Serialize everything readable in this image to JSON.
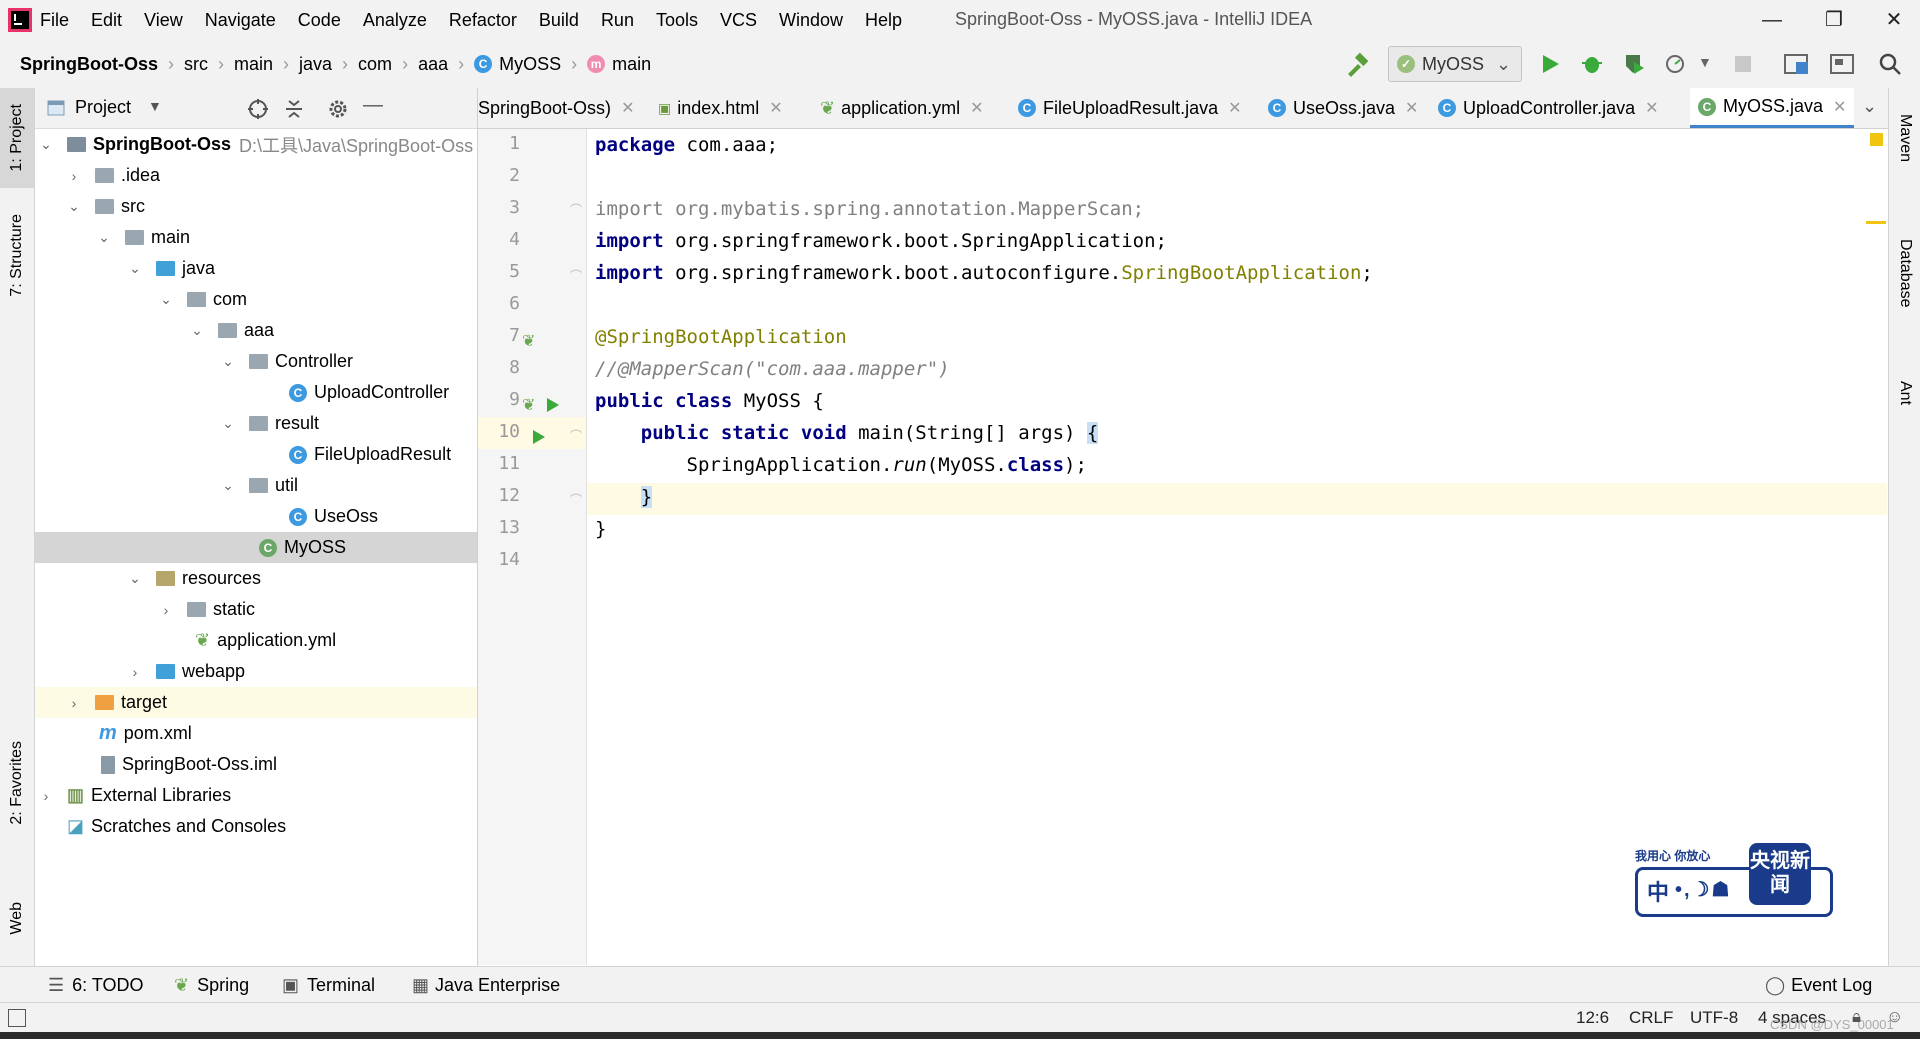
{
  "titlebar": {
    "menu": [
      "File",
      "Edit",
      "View",
      "Navigate",
      "Code",
      "Analyze",
      "Refactor",
      "Build",
      "Run",
      "Tools",
      "VCS",
      "Window",
      "Help"
    ],
    "title": "SpringBoot-Oss - MyOSS.java - IntelliJ IDEA",
    "minimize": "—",
    "restore": "❐",
    "close": "✕"
  },
  "navbar": {
    "breadcrumbs": [
      "SpringBoot-Oss",
      "src",
      "main",
      "java",
      "com",
      "aaa",
      "MyOSS",
      "main"
    ],
    "run_config": "MyOSS"
  },
  "leftstrip": {
    "project": "1: Project",
    "structure": "7: Structure",
    "favorites": "2: Favorites",
    "web": "Web"
  },
  "rightstrip": {
    "maven": "Maven",
    "database": "Database",
    "ant": "Ant"
  },
  "project": {
    "header_label": "Project",
    "root_name": "SpringBoot-Oss",
    "root_path": "D:\\工具\\Java\\SpringBoot-Oss",
    "items": [
      ".idea",
      "src",
      "main",
      "java",
      "com",
      "aaa",
      "Controller",
      "UploadController",
      "result",
      "FileUploadResult",
      "util",
      "UseOss",
      "MyOSS",
      "resources",
      "static",
      "application.yml",
      "webapp",
      "target",
      "pom.xml",
      "SpringBoot-Oss.iml",
      "External Libraries",
      "Scratches and Consoles"
    ]
  },
  "tabs": [
    {
      "label": "SpringBoot-Oss)"
    },
    {
      "label": "index.html"
    },
    {
      "label": "application.yml"
    },
    {
      "label": "FileUploadResult.java"
    },
    {
      "label": "UseOss.java"
    },
    {
      "label": "UploadController.java"
    },
    {
      "label": "MyOSS.java"
    }
  ],
  "editor": {
    "line_numbers": [
      "1",
      "2",
      "3",
      "4",
      "5",
      "6",
      "7",
      "8",
      "9",
      "10",
      "11",
      "12",
      "13",
      "14"
    ],
    "code": {
      "l1_kw": "package",
      "l1_rest": " com.aaa;",
      "l3": "import org.mybatis.spring.annotation.MapperScan;",
      "l4_kw": "import",
      "l4_rest": " org.springframework.boot.SpringApplication;",
      "l5_kw": "import",
      "l5_rest": " org.springframework.boot.autoconfigure.",
      "l5_ann": "SpringBootApplication",
      "l5_end": ";",
      "l7": "@SpringBootApplication",
      "l8": "//@MapperScan(\"com.aaa.mapper\")",
      "l9_kw": "public class",
      "l9_rest": " MyOSS {",
      "l10_indent": "    ",
      "l10_kw": "public static void",
      "l10_rest": " main(String[] args) ",
      "l10_brace": "{",
      "l11_pre": "        SpringApplication.",
      "l11_it": "run",
      "l11_mid": "(MyOSS.",
      "l11_kw": "class",
      "l11_end": ");",
      "l12_indent": "    ",
      "l12_brace": "}",
      "l13": "}"
    }
  },
  "bottombar": {
    "todo": "6: TODO",
    "spring": "Spring",
    "terminal": "Terminal",
    "java_enterprise": "Java Enterprise",
    "event_log": "Event Log"
  },
  "statusbar": {
    "position": "12:6",
    "line_sep": "CRLF",
    "encoding": "UTF-8",
    "indent": "4 spaces",
    "watermark": "CSDN @DYS_00001"
  },
  "logo": {
    "tagline": "我用心 你放心",
    "name": "央视新闻",
    "letter": "中"
  },
  "colors": {
    "keyword": "#000080",
    "annotation": "#808000",
    "comment": "#808080",
    "accent": "#4083c9",
    "class_icon": "#3d9ae0"
  }
}
